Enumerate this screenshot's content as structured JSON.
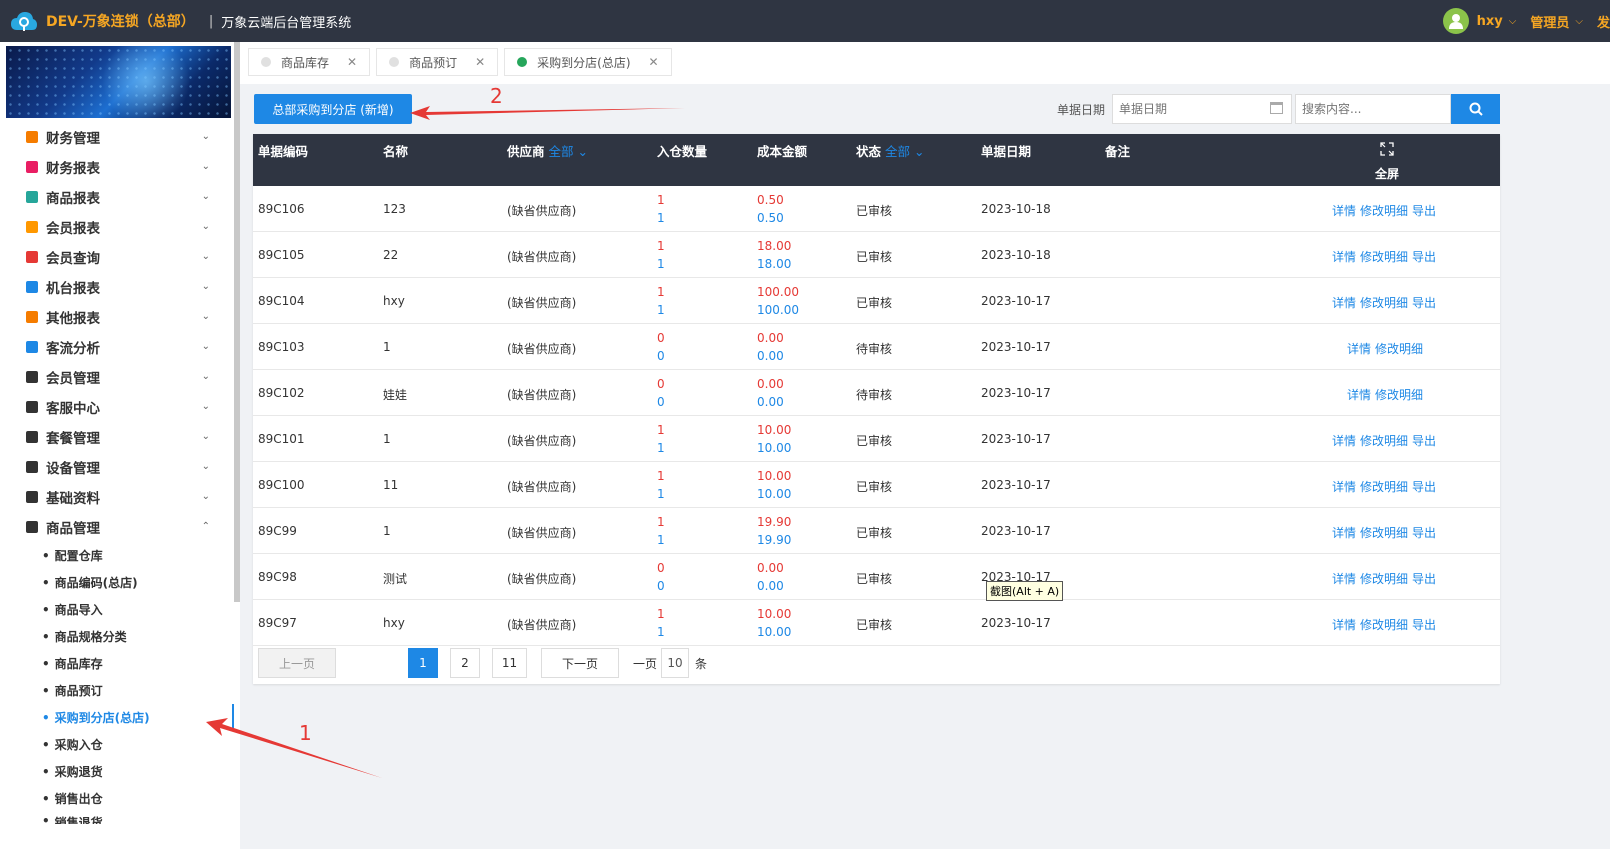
{
  "header": {
    "brand": "DEV-万象连锁（总部）",
    "separator": "|",
    "system_name": "万象云端后台管理系统",
    "user_name": "hxy",
    "role": "管理员",
    "truncated": "发"
  },
  "sidebar": {
    "menu": [
      {
        "label": "财务管理",
        "icon": "ledger-icon",
        "color": "#f57c00"
      },
      {
        "label": "财务报表",
        "icon": "report-icon",
        "color": "#e91e63"
      },
      {
        "label": "商品报表",
        "icon": "report-icon",
        "color": "#26a69a"
      },
      {
        "label": "会员报表",
        "icon": "report-icon",
        "color": "#ff9800"
      },
      {
        "label": "会员查询",
        "icon": "report-icon",
        "color": "#e53935"
      },
      {
        "label": "机台报表",
        "icon": "report-icon",
        "color": "#1e88e5"
      },
      {
        "label": "其他报表",
        "icon": "layers-icon",
        "color": "#f57c00"
      },
      {
        "label": "客流分析",
        "icon": "target-icon",
        "color": "#1e88e5"
      },
      {
        "label": "会员管理",
        "icon": "user-icon",
        "color": "#333333"
      },
      {
        "label": "客服中心",
        "icon": "headset-icon",
        "color": "#333333"
      },
      {
        "label": "套餐管理",
        "icon": "edit-icon",
        "color": "#333333"
      },
      {
        "label": "设备管理",
        "icon": "joystick-icon",
        "color": "#333333"
      },
      {
        "label": "基础资料",
        "icon": "file-icon",
        "color": "#333333"
      },
      {
        "label": "商品管理",
        "icon": "swap-icon",
        "color": "#333333"
      }
    ],
    "submenu": [
      "配置仓库",
      "商品编码(总店)",
      "商品导入",
      "商品规格分类",
      "商品库存",
      "商品预订",
      "采购到分店(总店)",
      "采购入仓",
      "采购退货",
      "销售出仓",
      "销售退货"
    ],
    "active_sub": "采购到分店(总店)"
  },
  "tabs": [
    {
      "label": "商品库存",
      "active": false
    },
    {
      "label": "商品预订",
      "active": false
    },
    {
      "label": "采购到分店(总店)",
      "active": true
    }
  ],
  "toolbar": {
    "add_label": "总部采购到分店 (新增)",
    "date_label": "单据日期",
    "date_placeholder": "单据日期",
    "search_placeholder": "搜索内容..."
  },
  "annotations": {
    "one": "1",
    "two": "2"
  },
  "table": {
    "headers": {
      "code": "单据编码",
      "name": "名称",
      "supplier": "供应商",
      "supplier_filter": "全部",
      "qty": "入仓数量",
      "cost": "成本金额",
      "status": "状态",
      "status_filter": "全部",
      "date": "单据日期",
      "note": "备注",
      "fullscreen": "全屏"
    },
    "rows": [
      {
        "code": "89C106",
        "name": "123",
        "supplier": "(缺省供应商)",
        "qty_top": "1",
        "qty_bottom": "1",
        "cost_top": "0.50",
        "cost_bottom": "0.50",
        "status": "已审核",
        "date": "2023-10-18",
        "ops": [
          "详情",
          "修改明细",
          "导出"
        ]
      },
      {
        "code": "89C105",
        "name": "22",
        "supplier": "(缺省供应商)",
        "qty_top": "1",
        "qty_bottom": "1",
        "cost_top": "18.00",
        "cost_bottom": "18.00",
        "status": "已审核",
        "date": "2023-10-18",
        "ops": [
          "详情",
          "修改明细",
          "导出"
        ]
      },
      {
        "code": "89C104",
        "name": "hxy",
        "supplier": "(缺省供应商)",
        "qty_top": "1",
        "qty_bottom": "1",
        "cost_top": "100.00",
        "cost_bottom": "100.00",
        "status": "已审核",
        "date": "2023-10-17",
        "ops": [
          "详情",
          "修改明细",
          "导出"
        ]
      },
      {
        "code": "89C103",
        "name": "1",
        "supplier": "(缺省供应商)",
        "qty_top": "0",
        "qty_bottom": "0",
        "cost_top": "0.00",
        "cost_bottom": "0.00",
        "status": "待审核",
        "date": "2023-10-17",
        "ops": [
          "详情",
          "修改明细"
        ]
      },
      {
        "code": "89C102",
        "name": "娃娃",
        "supplier": "(缺省供应商)",
        "qty_top": "0",
        "qty_bottom": "0",
        "cost_top": "0.00",
        "cost_bottom": "0.00",
        "status": "待审核",
        "date": "2023-10-17",
        "ops": [
          "详情",
          "修改明细"
        ]
      },
      {
        "code": "89C101",
        "name": "1",
        "supplier": "(缺省供应商)",
        "qty_top": "1",
        "qty_bottom": "1",
        "cost_top": "10.00",
        "cost_bottom": "10.00",
        "status": "已审核",
        "date": "2023-10-17",
        "ops": [
          "详情",
          "修改明细",
          "导出"
        ]
      },
      {
        "code": "89C100",
        "name": "11",
        "supplier": "(缺省供应商)",
        "qty_top": "1",
        "qty_bottom": "1",
        "cost_top": "10.00",
        "cost_bottom": "10.00",
        "status": "已审核",
        "date": "2023-10-17",
        "ops": [
          "详情",
          "修改明细",
          "导出"
        ]
      },
      {
        "code": "89C99",
        "name": "1",
        "supplier": "(缺省供应商)",
        "qty_top": "1",
        "qty_bottom": "1",
        "cost_top": "19.90",
        "cost_bottom": "19.90",
        "status": "已审核",
        "date": "2023-10-17",
        "ops": [
          "详情",
          "修改明细",
          "导出"
        ]
      },
      {
        "code": "89C98",
        "name": "测试",
        "supplier": "(缺省供应商)",
        "qty_top": "0",
        "qty_bottom": "0",
        "cost_top": "0.00",
        "cost_bottom": "0.00",
        "status": "已审核",
        "date": "2023-10-17",
        "ops": [
          "详情",
          "修改明细",
          "导出"
        ]
      },
      {
        "code": "89C97",
        "name": "hxy",
        "supplier": "(缺省供应商)",
        "qty_top": "1",
        "qty_bottom": "1",
        "cost_top": "10.00",
        "cost_bottom": "10.00",
        "status": "已审核",
        "date": "2023-10-17",
        "ops": [
          "详情",
          "修改明细",
          "导出"
        ]
      }
    ]
  },
  "pagination": {
    "prev": "上一页",
    "pages": [
      "1",
      "2",
      "11"
    ],
    "current": "1",
    "next": "下一页",
    "per_page_label": "一页",
    "per_page_value": "10",
    "per_page_unit": "条"
  },
  "tooltip": "截图(Alt + A)",
  "colors": {
    "accent": "#1e88e5",
    "header_bg": "#2f3542",
    "brand": "#f5a623",
    "negative": "#e53935"
  }
}
